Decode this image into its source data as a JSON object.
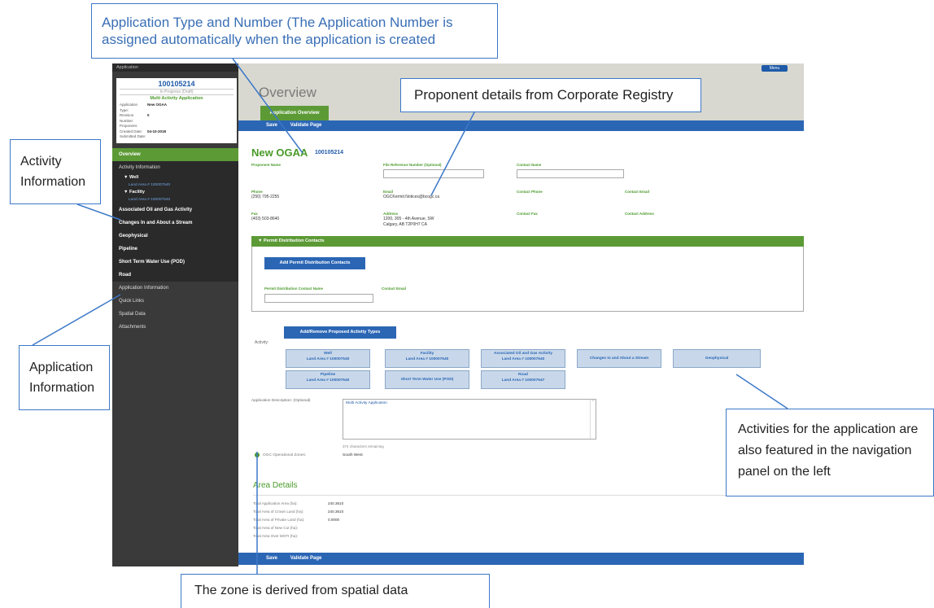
{
  "annotations": {
    "app_type_number": "Application Type and Number (The Application Number is assigned automatically when the application is created",
    "proponent": "Proponent details from Corporate Registry",
    "activity_info": "Activity Information",
    "application_info": "Application Information",
    "activities_nav": "Activities for the application are also featured in the navigation panel on the left",
    "zone": "The zone is derived from spatial data"
  },
  "sidebar": {
    "header": "Application",
    "card": {
      "number": "100105214",
      "status": "In Progress (Draft)",
      "type": "Multi Activity Application",
      "rows": [
        {
          "k": "Application Type:",
          "v": "New OGAA"
        },
        {
          "k": "Revision Number:",
          "v": "0"
        },
        {
          "k": "Proponent:",
          "v": ""
        },
        {
          "k": "Created Date:",
          "v": "04-10-2018"
        },
        {
          "k": "Submitted Date:",
          "v": ""
        }
      ]
    },
    "overview": "Overview",
    "activity_information": "Activity Information",
    "well": "Well",
    "well_land": "Land Area # 100007540",
    "facility": "Facility",
    "facility_land": "Land Area # 100007540",
    "items": [
      "Associated Oil and Gas Activity",
      "Changes In and About a Stream",
      "Geophysical",
      "Pipeline",
      "Short Term Water Use (POD)",
      "Road"
    ],
    "application_information": "Application Information",
    "quick_links": "Quick Links",
    "spatial_data": "Spatial Data",
    "attachments": "Attachments"
  },
  "header": {
    "title": "Overview",
    "tab": "Application Overview",
    "menu": "Menu"
  },
  "toolbar": {
    "save": "Save",
    "validate": "Validate Page"
  },
  "proponent": {
    "title": "New OGAA",
    "number": "100105214",
    "name_label": "Proponent Name",
    "file_ref_label": "File Reference Number (Optional)",
    "contact_name_label": "Contact Name",
    "phone_label": "Phone",
    "phone": "(250) 795-2255",
    "email_label": "Email",
    "email": "OGCKermit.Notices@bcogc.ca",
    "contact_phone_label": "Contact Phone",
    "contact_email_label": "Contact Email",
    "fax_label": "Fax",
    "fax": "(403) 503-8640",
    "address_label": "Address",
    "address_1": "1200, 305 - 4th Avenue, SW",
    "address_2": "Calgary, AB  T2P0H7 CA",
    "contact_fax_label": "Contact Fax",
    "contact_address_label": "Contact Address"
  },
  "permit": {
    "header": "Permit Distribution Contacts",
    "add_button": "Add Permit Distribution Contacts",
    "contact_name_label": "Permit Distribution Contact Name",
    "contact_email_label": "Contact Email"
  },
  "activity": {
    "label": "Activity:",
    "add_button": "Add/Remove Proposed Activity Types",
    "buttons": [
      {
        "l1": "Well",
        "l2": "Land Area # 100007540"
      },
      {
        "l1": "Facility",
        "l2": "Land Area # 100007540"
      },
      {
        "l1": "Associated Oil and Gas Activity",
        "l2": "Land Area # 100007540"
      },
      {
        "l1": "Changes In and About a Stream",
        "l2": ""
      },
      {
        "l1": "Geophysical",
        "l2": ""
      },
      {
        "l1": "Pipeline",
        "l2": "Land Area # 100007540"
      },
      {
        "l1": "Short Term Water Use (POD)",
        "l2": ""
      },
      {
        "l1": "Road",
        "l2": "Land Area # 100007547"
      }
    ]
  },
  "description": {
    "label": "Application Description: (Optional)",
    "value": "Multi Activity Application",
    "remaining": "374 characters remaining"
  },
  "zone": {
    "label": "OGC Operational Zones:",
    "value": "South West"
  },
  "area": {
    "title": "Area Details",
    "rows": [
      {
        "k": "Total Application Area (ha):",
        "v": "240.3610"
      },
      {
        "k": "Total Area of Crown Land (ha):",
        "v": "240.3610"
      },
      {
        "k": "Total Area of Private Land (ha):",
        "v": "0.0000"
      },
      {
        "k": "Total Area of New Cut (ha):",
        "v": ""
      },
      {
        "k": "Total Area Over MOTI (ha):",
        "v": ""
      }
    ]
  },
  "colors": {
    "accent_green": "#5c9a36",
    "accent_blue": "#2b66b5",
    "callout_border": "#3c78c8"
  }
}
